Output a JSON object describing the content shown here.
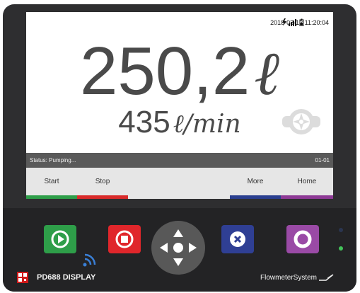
{
  "screen": {
    "datetime": "2018-03-12 11:20:04",
    "volume": {
      "value": "250,2",
      "unit": "ℓ"
    },
    "rate": {
      "value": "435",
      "unit": "ℓ/min"
    },
    "status_text": "Status: Pumping...",
    "page": "01-01"
  },
  "softkeys": [
    {
      "label": "Start",
      "color": "#2e9e49"
    },
    {
      "label": "Stop",
      "color": "#d82a2a"
    },
    {
      "label": "",
      "color": ""
    },
    {
      "label": "",
      "color": ""
    },
    {
      "label": "More",
      "color": "#2a3f8f"
    },
    {
      "label": "Home",
      "color": "#8e3a96"
    }
  ],
  "hardware": {
    "buttons": [
      {
        "name": "play",
        "color": "#2e9e49"
      },
      {
        "name": "stop",
        "color": "#e0262b"
      },
      {
        "name": "x",
        "color": "#2f3f94"
      },
      {
        "name": "circle",
        "color": "#9a4aa6"
      }
    ],
    "leds": [
      {
        "color": "#2a3550"
      },
      {
        "color": "#43c45a"
      }
    ],
    "model_label": "PD688 DISPLAY",
    "brand_label": "FlowmeterSystem"
  }
}
